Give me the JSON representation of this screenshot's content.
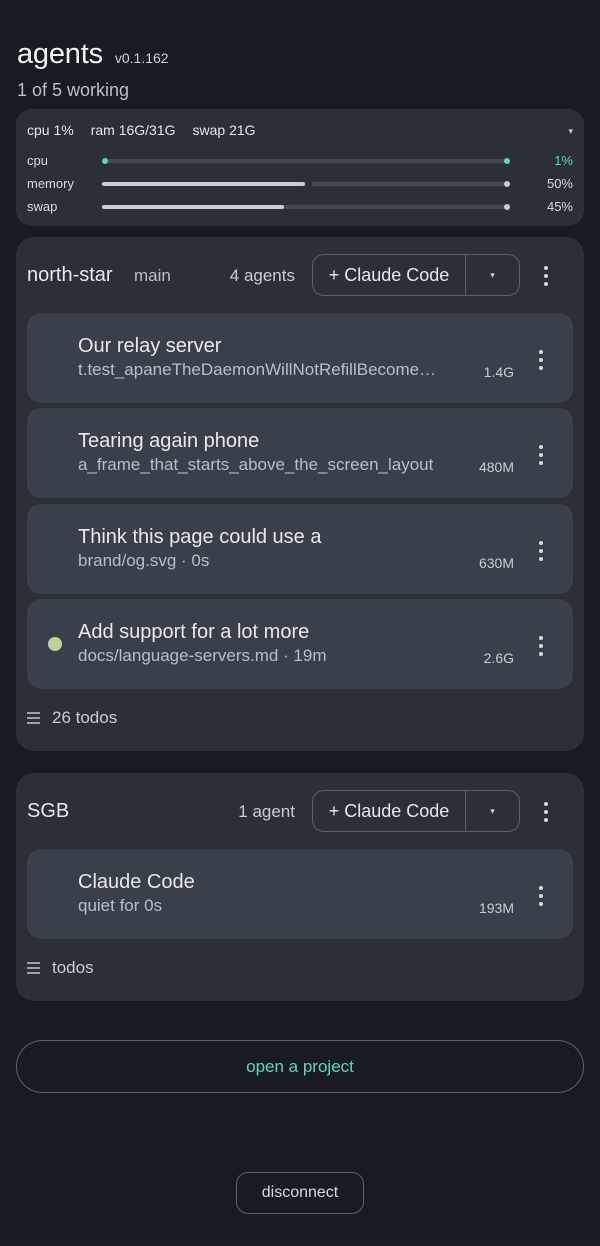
{
  "header": {
    "title": "agents",
    "version": "v0.1.162",
    "subtitle": "1 of 5 working"
  },
  "stats": {
    "summary": {
      "cpu": "cpu 1%",
      "ram": "ram 16G/31G",
      "swap": "swap 21G"
    },
    "toggle_icon": "▾",
    "rows": [
      {
        "label": "cpu",
        "value": "1%",
        "fraction": 0.01
      },
      {
        "label": "memory",
        "value": "50%",
        "fraction": 0.5
      },
      {
        "label": "swap",
        "value": "45%",
        "fraction": 0.45
      }
    ],
    "colors": {
      "accent": "#5cd6bf"
    }
  },
  "projects": [
    {
      "name": "north-star",
      "branch": "main",
      "agent_count": "4 agents",
      "new_button": "+ Claude Code",
      "dropdown_icon": "▾",
      "agents": [
        {
          "title": "Our relay server",
          "subtitle": "t.test_apaneTheDaemonWillNotRefillBecomesItFinished",
          "memory": "1.4G",
          "working": false
        },
        {
          "title": "Tearing again phone",
          "subtitle": "a_frame_that_starts_above_the_screen_layout",
          "memory": "480M",
          "working": false
        },
        {
          "title": "Think this page could use a",
          "subtitle": "brand/og.svg · 0s",
          "memory": "630M",
          "working": false
        },
        {
          "title": "Add support for a lot more",
          "subtitle": "docs/language-servers.md · 19m",
          "memory": "2.6G",
          "working": true
        }
      ],
      "todos": "26 todos"
    },
    {
      "name": "SGB",
      "agent_count": "1 agent",
      "new_button": "+ Claude Code",
      "dropdown_icon": "▾",
      "agents": [
        {
          "title": "Claude Code",
          "subtitle": "quiet for 0s",
          "memory": "193M",
          "working": false
        }
      ],
      "todos": "todos"
    }
  ],
  "actions": {
    "open_project": "open a project",
    "disconnect": "disconnect"
  }
}
